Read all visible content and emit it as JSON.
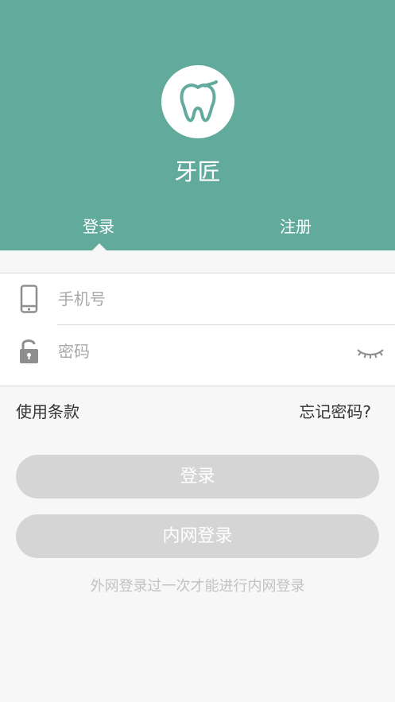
{
  "app": {
    "title": "牙匠",
    "brand_color": "#62aa9c",
    "logo_icon": "tooth-icon"
  },
  "tabs": [
    {
      "label": "登录",
      "active": true
    },
    {
      "label": "注册",
      "active": false
    }
  ],
  "form": {
    "phone": {
      "icon": "mobile-phone-icon",
      "placeholder": "手机号",
      "value": ""
    },
    "password": {
      "icon": "lock-icon",
      "placeholder": "密码",
      "value": "",
      "toggle_icon": "eye-closed-icon"
    }
  },
  "links": {
    "terms": "使用条款",
    "forgot": "忘记密码?"
  },
  "buttons": {
    "login": "登录",
    "intranet_login": "内网登录",
    "disabled_color": "#d5d5d5"
  },
  "hint": "外网登录过一次才能进行内网登录"
}
